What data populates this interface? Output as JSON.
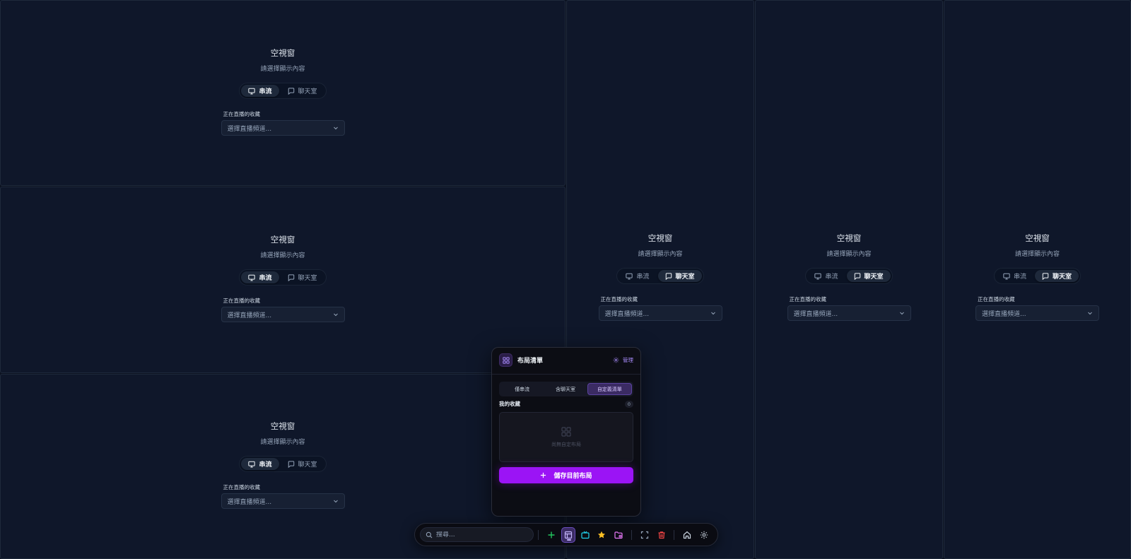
{
  "pane": {
    "title": "空視窗",
    "subtitle": "請選擇顯示內容",
    "stream_label": "串流",
    "chat_label": "聊天室",
    "field_label": "正在直播的收藏",
    "select_placeholder": "選擇直播頻道..."
  },
  "panes": [
    {
      "mode": "stream"
    },
    {
      "mode": "stream"
    },
    {
      "mode": "stream"
    },
    {
      "mode": "chat"
    },
    {
      "mode": "chat"
    },
    {
      "mode": "chat"
    }
  ],
  "popup": {
    "title": "布局清單",
    "manage_label": "管理",
    "tabs": [
      "僅串流",
      "含聊天室",
      "自定義清單"
    ],
    "active_tab": 2,
    "favorites_label": "我的收藏",
    "favorites_count": "0",
    "empty_text": "尚無自定布局",
    "save_label": "儲存目前布局"
  },
  "toolbar": {
    "search_placeholder": "搜尋...",
    "buttons": [
      "plus-icon",
      "layout-icon",
      "tv-icon",
      "star-icon",
      "folder-icon",
      "fullscreen-icon",
      "trash-icon",
      "home-icon",
      "settings-icon"
    ],
    "active_button": "layout-icon"
  },
  "colors": {
    "background": "#0b1120",
    "pane": "#0f172a",
    "accent": "#9b14f5",
    "accent_soft": "#a78bfa"
  }
}
